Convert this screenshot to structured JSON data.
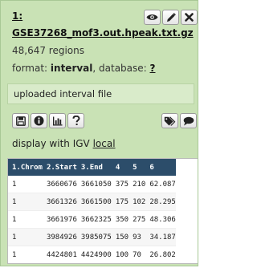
{
  "dataset": {
    "hid": "1:",
    "name": "GSE37268_mof3.out.hpeak.txt.gz",
    "regions": "48,647 regions",
    "format_label": "format: ",
    "format_value": "interval",
    "database_label": ", database: ",
    "database_value": "?",
    "info": "uploaded interval file",
    "display_label": "display with IGV ",
    "display_link": "local"
  },
  "top_actions": {
    "icons": [
      "eye-icon",
      "pencil-icon",
      "close-icon"
    ]
  },
  "secondary_actions": {
    "left_icons": [
      "save-icon",
      "info-icon",
      "chart-icon",
      "question-icon"
    ],
    "right_icons": [
      "tag-icon",
      "comment-icon"
    ]
  },
  "table": {
    "headers": [
      "1.Chrom",
      "2.Start",
      "3.End",
      "4",
      "5",
      "6"
    ],
    "rows": [
      [
        "1",
        "3660676",
        "3661050",
        "375",
        "210",
        "62.087"
      ],
      [
        "1",
        "3661326",
        "3661500",
        "175",
        "102",
        "28.295"
      ],
      [
        "1",
        "3661976",
        "3662325",
        "350",
        "275",
        "48.306"
      ],
      [
        "1",
        "3984926",
        "3985075",
        "150",
        "93",
        "34.187"
      ],
      [
        "1",
        "4424801",
        "4424900",
        "100",
        "70",
        "26.802"
      ]
    ]
  }
}
